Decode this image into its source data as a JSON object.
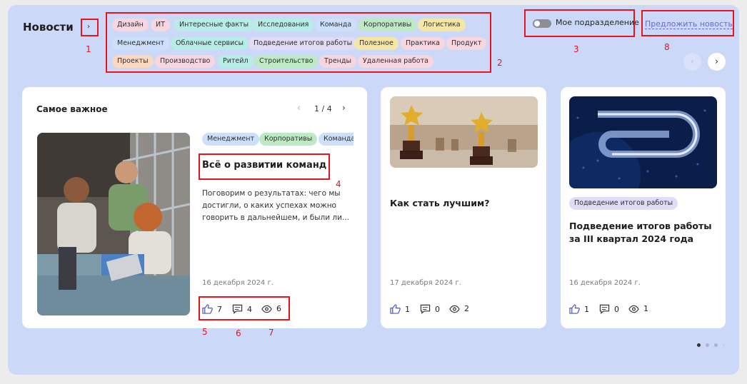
{
  "header": {
    "title": "Новости",
    "expand_icon": "chevron-right-icon",
    "toggle_label": "Мое подразделение",
    "suggest_link": "Предложить новость",
    "prev_icon": "chevron-left-icon",
    "next_icon": "chevron-right-icon"
  },
  "tags": [
    {
      "label": "Дизайн",
      "color": "#f7d6e0"
    },
    {
      "label": "ИТ",
      "color": "#f7d6e0"
    },
    {
      "label": "Интересные факты",
      "color": "#b8ece6"
    },
    {
      "label": "Исследования",
      "color": "#b8ece6"
    },
    {
      "label": "Команда",
      "color": "#cde0fb"
    },
    {
      "label": "Корпоративы",
      "color": "#bdeac3"
    },
    {
      "label": "Логистика",
      "color": "#f6e6a4"
    },
    {
      "label": "Менеджмент",
      "color": "#cde0fb"
    },
    {
      "label": "Облачные сервисы",
      "color": "#b8ece6"
    },
    {
      "label": "Подведение итогов работы",
      "color": "#e2dbf6"
    },
    {
      "label": "Полезное",
      "color": "#f6e6a4"
    },
    {
      "label": "Практика",
      "color": "#f7d6e0"
    },
    {
      "label": "Продукт",
      "color": "#f7d6e0"
    },
    {
      "label": "Проекты",
      "color": "#fbd8bf"
    },
    {
      "label": "Производство",
      "color": "#f7d6e0"
    },
    {
      "label": "Ритейл",
      "color": "#b8ece6"
    },
    {
      "label": "Строительство",
      "color": "#bdeac3"
    },
    {
      "label": "Тренды",
      "color": "#f7d6e0"
    },
    {
      "label": "Удаленная работа",
      "color": "#f7d6e0"
    }
  ],
  "main_card": {
    "heading": "Самое важное",
    "pager": "1 / 4",
    "tags": [
      "Менеджмент",
      "Корпоративы",
      "Команда"
    ],
    "title": "Всё о развитии команд",
    "excerpt_lines": [
      "Поговорим о результатах: чего мы",
      "достигли, о каких успехах можно",
      "говорить в дальнейшем, и были ли..."
    ],
    "date": "16 декабря 2024 г.",
    "likes": "7",
    "comments": "4",
    "views": "6"
  },
  "card2": {
    "title": "Как стать лучшим?",
    "date": "17 декабря 2024 г.",
    "likes": "1",
    "comments": "0",
    "views": "2"
  },
  "card3": {
    "tag": "Подведение итогов работы",
    "title_lines": [
      "Подведение итогов работы",
      "за III квартал 2024 года"
    ],
    "date": "16 декабря 2024 г.",
    "likes": "1",
    "comments": "0",
    "views": "1"
  },
  "annotations": {
    "a1": "1",
    "a2": "2",
    "a3": "3",
    "a4": "4",
    "a5": "5",
    "a6": "6",
    "a7": "7",
    "a8": "8"
  },
  "colors": {
    "panel": "#ccd8f7",
    "accent": "#6b67d6",
    "annotation_red": "#e8131b"
  }
}
